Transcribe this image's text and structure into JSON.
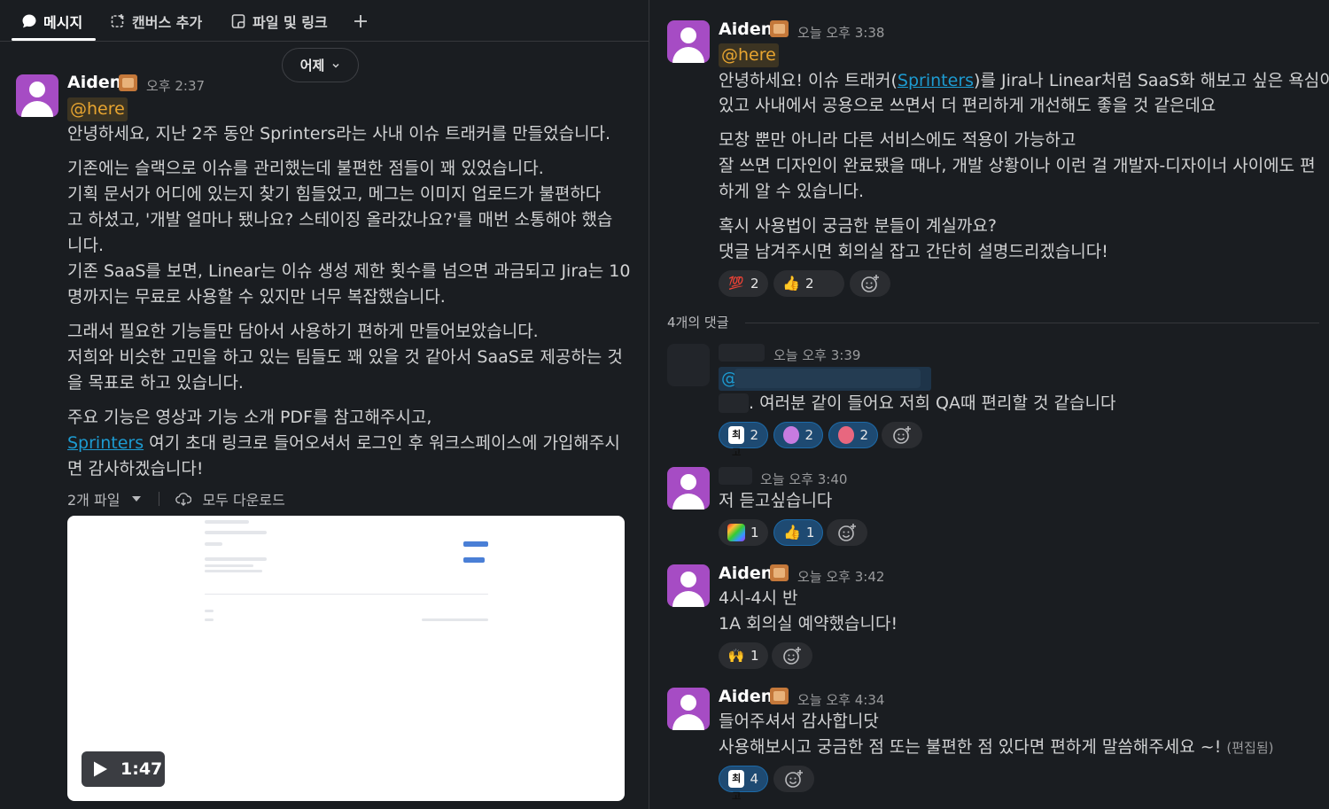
{
  "tabs": [
    {
      "label": "메시지"
    },
    {
      "label": "캔버스 추가"
    },
    {
      "label": "파일 및 링크"
    }
  ],
  "day_divider": "어제",
  "left_message": {
    "author": "Aiden",
    "time": "오후 2:37",
    "mention": "@here",
    "lines": [
      "안녕하세요, 지난 2주 동안 Sprinters라는 사내 이슈 트래커를 만들었습니다.",
      "기존에는 슬랙으로 이슈를 관리했는데 불편한 점들이 꽤 있었습니다.",
      "기획 문서가 어디에 있는지 찾기 힘들었고, 메그는 이미지 업로드가 불편하다",
      "고 하셨고, '개발 얼마나 됐나요? 스테이징 올라갔나요?'를 매번 소통해야 했습",
      "니다.",
      "기존 SaaS를 보면, Linear는 이슈 생성 제한 횟수를 넘으면 과금되고 Jira는 10",
      "명까지는 무료로 사용할 수 있지만 너무 복잡했습니다.",
      "그래서 필요한 기능들만 담아서 사용하기 편하게 만들어보았습니다.",
      "저희와 비슷한 고민을 하고 있는 팀들도 꽤 있을 것 같아서 SaaS로 제공하는 것",
      "을 목표로 하고 있습니다.",
      "주요 기능은 영상과 기능 소개 PDF를 참고해주시고,",
      "여기 초대 링크로 들어오셔서 로그인 후 워크스페이스에 가입해주시",
      "면 감사하겠습니다!"
    ],
    "link_text": "Sprinters",
    "files_count": "2개 파일",
    "download_all": "모두 다운로드",
    "video_duration": "1:47"
  },
  "thread_parent": {
    "author": "Aiden",
    "time": "오늘 오후 3:38",
    "mention": "@here",
    "line1_pre": "안녕하세요! 이슈 트래커(",
    "line1_link": "Sprinters",
    "line1_post": ")를 Jira나 Linear처럼 SaaS화 해보고 싶은 욕심이",
    "lines": [
      "있고 사내에서 공용으로 쓰면서 더 편리하게 개선해도 좋을 것 같은데요",
      "모창 뿐만 아니라 다른 서비스에도 적용이 가능하고",
      "잘 쓰면 디자인이 완료됐을 때나, 개발 상황이나 이런 걸 개발자-디자이너 사이에도 편",
      "하게 알 수 있습니다.",
      "혹시 사용법이 궁금한 분들이 계실까요?",
      "댓글 남겨주시면 회의실 잡고 간단히 설명드리겠습니다!"
    ],
    "reactions": [
      {
        "emoji": "100-icon",
        "count": "2"
      },
      {
        "emoji": "thumbsup-icon",
        "count": "2"
      }
    ]
  },
  "replies_label": "4개의 댓글",
  "replies": [
    {
      "time": "오늘 오후 3:39",
      "mention_prefix": "@",
      "text": ". 여러분 같이 들어요 저희 QA때 편리할 것 같습니다",
      "reactions": [
        {
          "emoji": "best-icon",
          "count": "2"
        },
        {
          "emoji": "blob-icon",
          "count": "2"
        },
        {
          "emoji": "brain-icon",
          "count": "2"
        }
      ]
    },
    {
      "time": "오늘 오후 3:40",
      "text": "저 듣고싶습니다",
      "reactions": [
        {
          "emoji": "rainbow-icon",
          "count": "1"
        },
        {
          "emoji": "thumbsup-icon",
          "count": "1"
        }
      ]
    },
    {
      "author": "Aiden",
      "time": "오늘 오후 3:42",
      "lines": [
        "4시-4시 반",
        "1A 회의실 예약했습니다!"
      ],
      "reactions": [
        {
          "emoji": "raised-hands-icon",
          "count": "1"
        }
      ]
    },
    {
      "author": "Aiden",
      "time": "오늘 오후 4:34",
      "lines": [
        "들어주셔서 감사합니닷",
        "사용해보시고 궁금한 점 또는 불편한 점 있다면 편하게 말씀해주세요 ~!"
      ],
      "edited": "(편집됨)",
      "reactions": [
        {
          "emoji": "best-icon",
          "count": "4"
        }
      ]
    }
  ],
  "colors": {
    "background": "#1a1d21",
    "mention": "#e8a530",
    "link": "#1d9bd1",
    "avatar": "#a64cc4",
    "reaction_mine": "#1e4a72"
  }
}
